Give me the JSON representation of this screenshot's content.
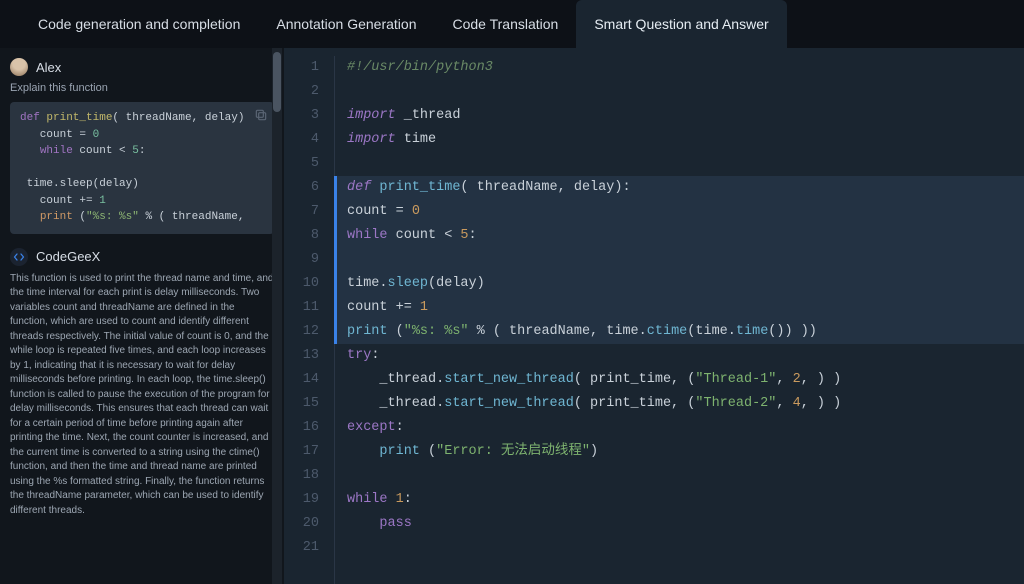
{
  "tabs": [
    {
      "label": "Code generation and completion",
      "active": false
    },
    {
      "label": "Annotation Generation",
      "active": false
    },
    {
      "label": "Code Translation",
      "active": false
    },
    {
      "label": "Smart Question and Answer",
      "active": true
    }
  ],
  "sidebar": {
    "user": {
      "name": "Alex"
    },
    "prompt": "Explain this function",
    "snippet": {
      "lines": [
        {
          "tokens": [
            {
              "t": "def ",
              "c": "tok-kw"
            },
            {
              "t": "print_time",
              "c": "tok-fn"
            },
            {
              "t": "( threadName, delay)",
              "c": "tok-var"
            }
          ]
        },
        {
          "tokens": [
            {
              "t": "   count ",
              "c": "tok-var"
            },
            {
              "t": "= ",
              "c": "tok-var"
            },
            {
              "t": "0",
              "c": "tok-num"
            }
          ]
        },
        {
          "tokens": [
            {
              "t": "   ",
              "c": ""
            },
            {
              "t": "while ",
              "c": "tok-kw"
            },
            {
              "t": "count ",
              "c": "tok-var"
            },
            {
              "t": "< ",
              "c": "tok-var"
            },
            {
              "t": "5",
              "c": "tok-num"
            },
            {
              "t": ":",
              "c": "tok-var"
            }
          ]
        },
        {
          "tokens": [
            {
              "t": " ",
              "c": ""
            }
          ]
        },
        {
          "tokens": [
            {
              "t": " time.sleep(delay)",
              "c": "tok-var"
            }
          ]
        },
        {
          "tokens": [
            {
              "t": "   count ",
              "c": "tok-var"
            },
            {
              "t": "+= ",
              "c": "tok-var"
            },
            {
              "t": "1",
              "c": "tok-num"
            }
          ]
        },
        {
          "tokens": [
            {
              "t": "   ",
              "c": ""
            },
            {
              "t": "print ",
              "c": "tok-builtin"
            },
            {
              "t": "(",
              "c": "tok-var"
            },
            {
              "t": "\"%s: %s\"",
              "c": "tok-str"
            },
            {
              "t": " % ( threadName,",
              "c": "tok-var"
            }
          ]
        }
      ]
    },
    "bot": {
      "name": "CodeGeeX"
    },
    "explanation": "This function is used to print the thread name and time, and the time interval for each print is delay milliseconds. Two variables count and threadName are defined in the function, which are used to count and identify different threads respectively. The initial value of count is 0, and the while loop is repeated five times, and each loop increases by 1, indicating that it is necessary to wait for delay milliseconds before printing. In each loop, the time.sleep() function is called to pause the execution of the program for delay milliseconds. This ensures that each thread can wait for a certain period of time before printing again after printing the time. Next, the count counter is increased, and the current time is converted to a string using the ctime() function, and then the time and thread name are printed using the %s formatted string. Finally, the function returns the threadName parameter, which can be used to identify different threads."
  },
  "editor": {
    "lines": [
      {
        "n": 1,
        "sel": false,
        "tokens": [
          {
            "t": "#!/usr/bin/python3",
            "c": "ed-com"
          }
        ]
      },
      {
        "n": 2,
        "sel": false,
        "tokens": [
          {
            "t": " ",
            "c": ""
          }
        ]
      },
      {
        "n": 3,
        "sel": false,
        "tokens": [
          {
            "t": "import ",
            "c": "ed-kw"
          },
          {
            "t": "_thread",
            "c": "ed-mod"
          }
        ]
      },
      {
        "n": 4,
        "sel": false,
        "tokens": [
          {
            "t": "import ",
            "c": "ed-kw"
          },
          {
            "t": "time",
            "c": "ed-mod"
          }
        ]
      },
      {
        "n": 5,
        "sel": false,
        "tokens": [
          {
            "t": " ",
            "c": ""
          }
        ]
      },
      {
        "n": 6,
        "sel": true,
        "tokens": [
          {
            "t": "def ",
            "c": "ed-kw"
          },
          {
            "t": "print_time",
            "c": "ed-fn"
          },
          {
            "t": "( threadName, delay):",
            "c": "ed-id"
          }
        ]
      },
      {
        "n": 7,
        "sel": true,
        "tokens": [
          {
            "t": "count ",
            "c": "ed-id"
          },
          {
            "t": "= ",
            "c": "ed-op"
          },
          {
            "t": "0",
            "c": "ed-num"
          }
        ]
      },
      {
        "n": 8,
        "sel": true,
        "tokens": [
          {
            "t": "while ",
            "c": "ed-kw2"
          },
          {
            "t": "count ",
            "c": "ed-id"
          },
          {
            "t": "< ",
            "c": "ed-op"
          },
          {
            "t": "5",
            "c": "ed-num"
          },
          {
            "t": ":",
            "c": "ed-id"
          }
        ]
      },
      {
        "n": 9,
        "sel": true,
        "tokens": [
          {
            "t": " ",
            "c": ""
          }
        ]
      },
      {
        "n": 10,
        "sel": true,
        "tokens": [
          {
            "t": "time.",
            "c": "ed-id"
          },
          {
            "t": "sleep",
            "c": "ed-call"
          },
          {
            "t": "(delay)",
            "c": "ed-id"
          }
        ]
      },
      {
        "n": 11,
        "sel": true,
        "tokens": [
          {
            "t": "count ",
            "c": "ed-id"
          },
          {
            "t": "+= ",
            "c": "ed-op"
          },
          {
            "t": "1",
            "c": "ed-num"
          }
        ]
      },
      {
        "n": 12,
        "sel": true,
        "tokens": [
          {
            "t": "print ",
            "c": "ed-call"
          },
          {
            "t": "(",
            "c": "ed-id"
          },
          {
            "t": "\"%s: %s\"",
            "c": "ed-str"
          },
          {
            "t": " % ( threadName, time.",
            "c": "ed-id"
          },
          {
            "t": "ctime",
            "c": "ed-call"
          },
          {
            "t": "(time.",
            "c": "ed-id"
          },
          {
            "t": "time",
            "c": "ed-call"
          },
          {
            "t": "()) ))",
            "c": "ed-id"
          }
        ]
      },
      {
        "n": 13,
        "sel": false,
        "tokens": [
          {
            "t": "try",
            "c": "ed-kw2"
          },
          {
            "t": ":",
            "c": "ed-id"
          }
        ]
      },
      {
        "n": 14,
        "sel": false,
        "tokens": [
          {
            "t": "    _thread.",
            "c": "ed-id"
          },
          {
            "t": "start_new_thread",
            "c": "ed-call"
          },
          {
            "t": "( print_time, (",
            "c": "ed-id"
          },
          {
            "t": "\"Thread-1\"",
            "c": "ed-str"
          },
          {
            "t": ", ",
            "c": "ed-id"
          },
          {
            "t": "2",
            "c": "ed-num"
          },
          {
            "t": ", ) )",
            "c": "ed-id"
          }
        ]
      },
      {
        "n": 15,
        "sel": false,
        "tokens": [
          {
            "t": "    _thread.",
            "c": "ed-id"
          },
          {
            "t": "start_new_thread",
            "c": "ed-call"
          },
          {
            "t": "( print_time, (",
            "c": "ed-id"
          },
          {
            "t": "\"Thread-2\"",
            "c": "ed-str"
          },
          {
            "t": ", ",
            "c": "ed-id"
          },
          {
            "t": "4",
            "c": "ed-num"
          },
          {
            "t": ", ) )",
            "c": "ed-id"
          }
        ]
      },
      {
        "n": 16,
        "sel": false,
        "tokens": [
          {
            "t": "except",
            "c": "ed-kw2"
          },
          {
            "t": ":",
            "c": "ed-id"
          }
        ]
      },
      {
        "n": 17,
        "sel": false,
        "tokens": [
          {
            "t": "    ",
            "c": ""
          },
          {
            "t": "print ",
            "c": "ed-call"
          },
          {
            "t": "(",
            "c": "ed-id"
          },
          {
            "t": "\"Error: 无法启动线程\"",
            "c": "ed-str"
          },
          {
            "t": ")",
            "c": "ed-id"
          }
        ]
      },
      {
        "n": 18,
        "sel": false,
        "tokens": [
          {
            "t": " ",
            "c": ""
          }
        ]
      },
      {
        "n": 19,
        "sel": false,
        "tokens": [
          {
            "t": "while ",
            "c": "ed-kw2"
          },
          {
            "t": "1",
            "c": "ed-num"
          },
          {
            "t": ":",
            "c": "ed-id"
          }
        ]
      },
      {
        "n": 20,
        "sel": false,
        "tokens": [
          {
            "t": "    ",
            "c": ""
          },
          {
            "t": "pass",
            "c": "ed-kw2"
          }
        ]
      },
      {
        "n": 21,
        "sel": false,
        "tokens": [
          {
            "t": " ",
            "c": ""
          }
        ]
      }
    ]
  }
}
